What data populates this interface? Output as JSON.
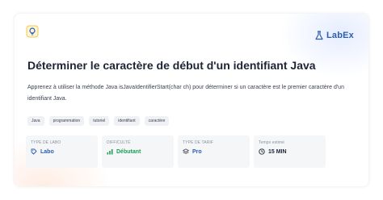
{
  "brand": {
    "name": "LabEx",
    "color": "#2a5db0"
  },
  "lab": {
    "title": "Déterminer le caractère de début d'un identifiant Java",
    "description": "Apprenez à utiliser la méthode Java isJavaIdentifierStart(char ch) pour déterminer si un caractère est le premier caractère d'un identifiant Java."
  },
  "tags": [
    "Java",
    "programmation",
    "tutoriel",
    "identifiant",
    "caractère"
  ],
  "stats": [
    {
      "label": "TYPE DE LABO",
      "value": "Labo",
      "icon": "tag-icon",
      "color": "#2a5db0"
    },
    {
      "label": "DIFFICULTÉ",
      "value": "Débutant",
      "icon": "signal-bars-icon",
      "color": "#18a058"
    },
    {
      "label": "TYPE DE TARIF",
      "value": "Pro",
      "icon": "layers-icon",
      "color": "#2a5db0"
    },
    {
      "label": "Temps estimé",
      "value": "15 MIN",
      "icon": "clock-icon",
      "color": "#1d2433"
    }
  ]
}
